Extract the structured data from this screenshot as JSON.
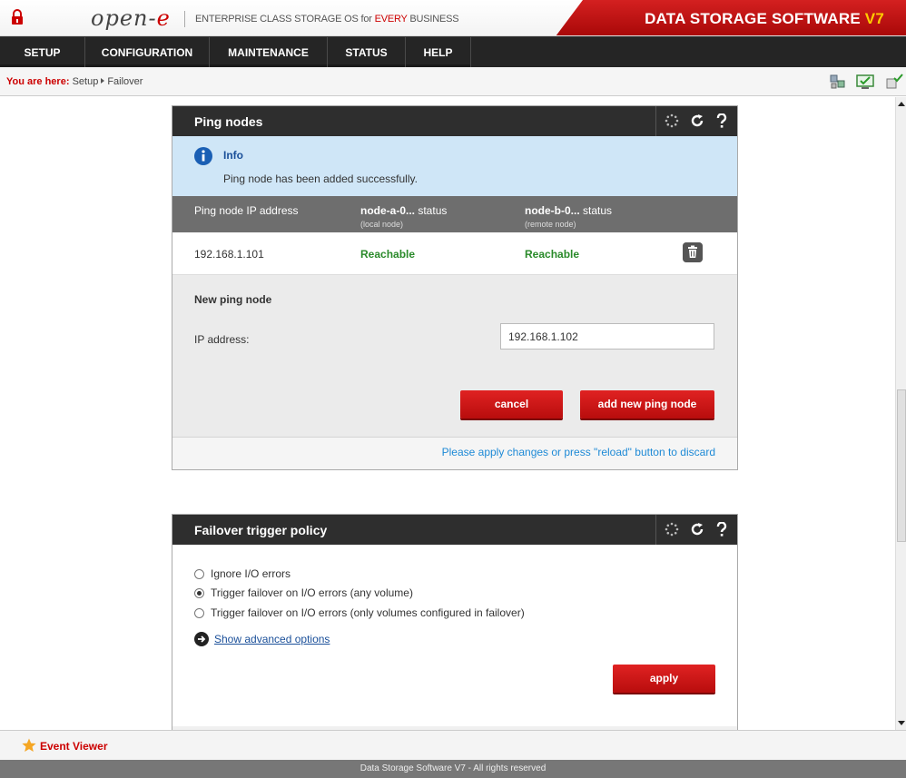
{
  "header": {
    "logo": "open-",
    "logo_e": "e",
    "tagline_pre": "ENTERPRISE CLASS STORAGE OS for ",
    "tagline_every": "EVERY",
    "tagline_post": " BUSINESS",
    "product": "DATA STORAGE SOFTWARE ",
    "product_version": "V7"
  },
  "nav": [
    {
      "label": "SETUP"
    },
    {
      "label": "CONFIGURATION"
    },
    {
      "label": "MAINTENANCE"
    },
    {
      "label": "STATUS"
    },
    {
      "label": "HELP"
    }
  ],
  "breadcrumb": {
    "label": "You are here:",
    "items": [
      "Setup",
      "Failover"
    ]
  },
  "ping_nodes": {
    "title": "Ping nodes",
    "info": {
      "title": "Info",
      "text": "Ping node has been added successfully."
    },
    "columns": {
      "ip": "Ping node IP address",
      "node_a": "node-a-0...",
      "node_a_suffix": " status",
      "node_a_sub": "(local node)",
      "node_b": "node-b-0...",
      "node_b_suffix": " status",
      "node_b_sub": "(remote node)"
    },
    "rows": [
      {
        "ip": "192.168.1.101",
        "node_a": "Reachable",
        "node_b": "Reachable"
      }
    ],
    "form": {
      "title": "New ping node",
      "ip_label": "IP address:",
      "ip_value": "192.168.1.102",
      "cancel_label": "cancel",
      "add_label": "add new ping node"
    },
    "apply_note": "Please apply changes or press \"reload\" button to discard"
  },
  "trigger_policy": {
    "title": "Failover trigger policy",
    "options": [
      {
        "label": "Ignore I/O errors",
        "selected": false
      },
      {
        "label": "Trigger failover on I/O errors (any volume)",
        "selected": true
      },
      {
        "label": "Trigger failover on I/O errors (only volumes configured in failover)",
        "selected": false
      }
    ],
    "advanced_label": "Show advanced options",
    "apply_label": "apply"
  },
  "footer": {
    "event_viewer": "Event Viewer",
    "copyright": "Data Storage Software V7 - All rights reserved"
  },
  "colors": {
    "brand_red": "#cc0000",
    "nav_bg": "#252525",
    "reachable": "#2a8a2a",
    "link": "#1e8ad6"
  }
}
